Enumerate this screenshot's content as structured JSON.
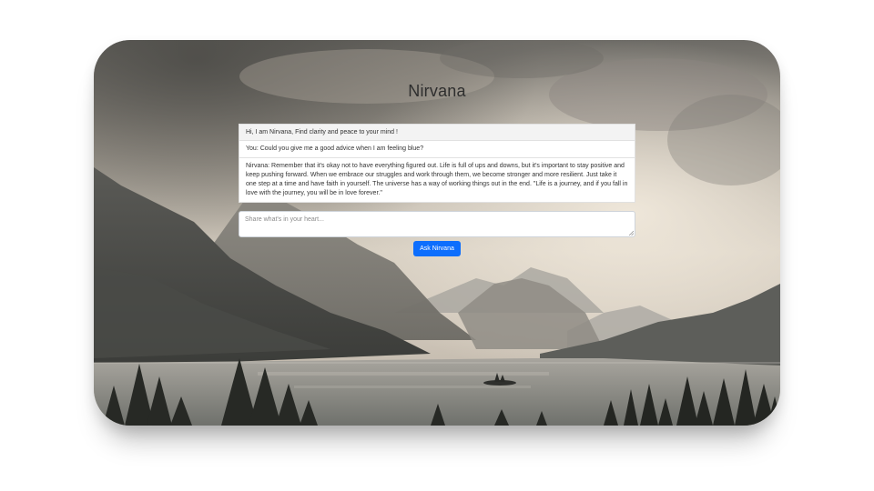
{
  "app": {
    "title": "Nirvana"
  },
  "chat": {
    "messages": [
      {
        "role": "bot",
        "text": "Hi, I am Nirvana, Find clarity and peace to your mind !"
      },
      {
        "role": "user",
        "text": "You: Could you give me a good advice when I am feeling blue?"
      },
      {
        "role": "bot",
        "text": "Nirvana: Remember that it's okay not to have everything figured out. Life is full of ups and downs, but it's important to stay positive and keep pushing forward. When we embrace our struggles and work through them, we become stronger and more resilient. Just take it one step at a time and have faith in yourself. The universe has a way of working things out in the end. \"Life is a journey, and if you fall in love with the journey, you will be in love forever.\""
      }
    ]
  },
  "input": {
    "placeholder": "Share what's in your heart...",
    "value": ""
  },
  "actions": {
    "ask_label": "Ask Nirvana"
  },
  "colors": {
    "button": "#0d6efd",
    "title_text": "#2e2e2e"
  },
  "icons": {
    "resize": "resize-grip-icon"
  }
}
